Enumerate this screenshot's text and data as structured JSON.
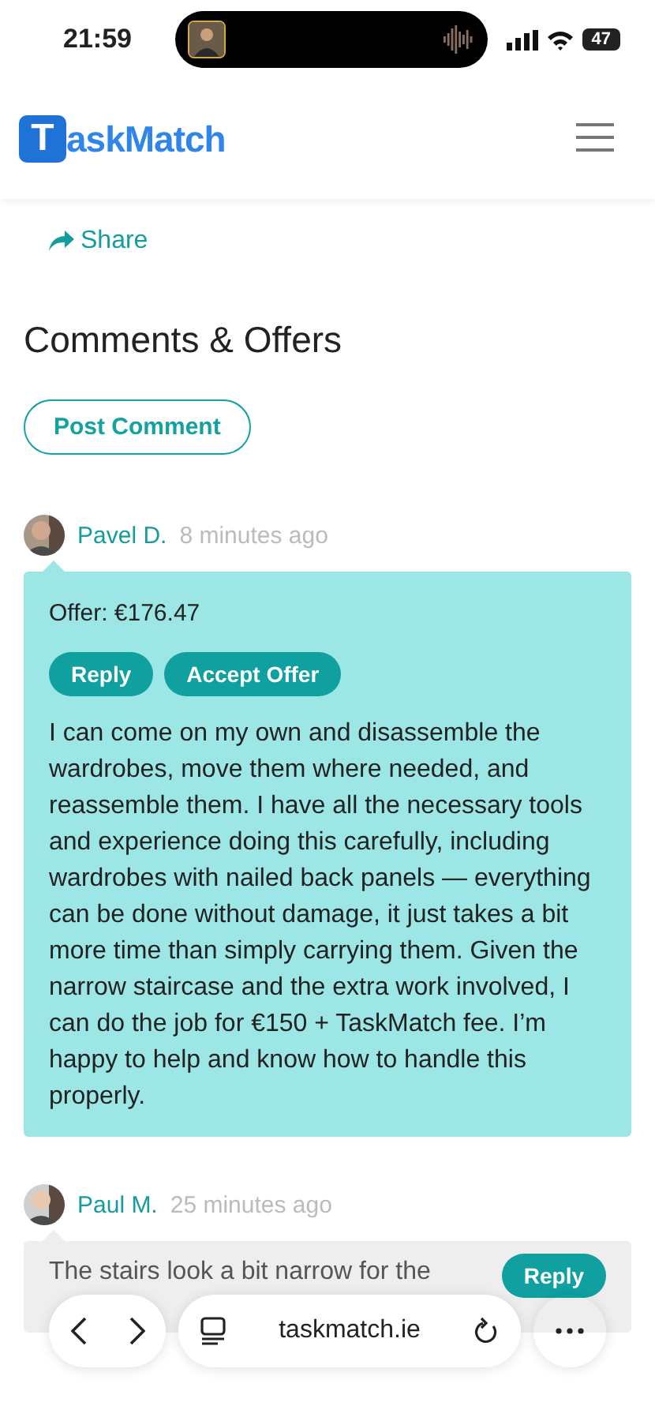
{
  "status_bar": {
    "time": "21:59",
    "battery": "47"
  },
  "header": {
    "logo_letter": "T",
    "logo_text": "askMatch"
  },
  "share": {
    "label": "Share"
  },
  "section": {
    "title": "Comments & Offers",
    "post_button": "Post Comment"
  },
  "comments": [
    {
      "kind": "offer",
      "author": "Pavel D.",
      "time": "8 minutes ago",
      "offer": "Offer: €176.47",
      "buttons": [
        "Reply",
        "Accept Offer"
      ],
      "text": "I can come on my own and disassemble the wardrobes, move them where needed, and reassemble them. I have all the necessary tools and experience doing this carefully, including wardrobes with nailed back panels — everything can be done without damage, it just takes a bit more time than simply carrying them. Given the narrow staircase and the extra work involved, I can do the job for €150 + TaskMatch fee. I’m happy to help and know how to handle this properly."
    },
    {
      "kind": "comment",
      "author": "Paul M.",
      "time": "25 minutes ago",
      "buttons": [
        "Reply"
      ],
      "text": "The stairs look a bit narrow for the"
    }
  ],
  "browser_bar": {
    "url": "taskmatch.ie"
  }
}
